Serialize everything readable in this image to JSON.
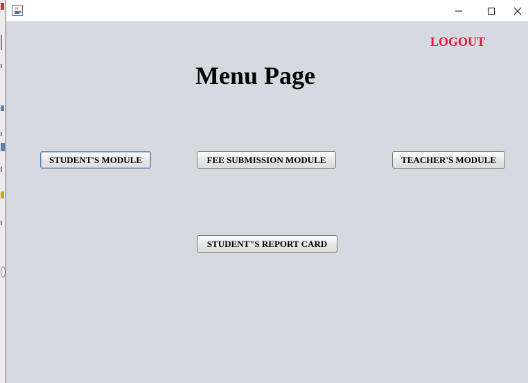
{
  "window": {
    "icon": "java-cup-icon",
    "controls": {
      "minimize_icon": "minimize-icon",
      "maximize_icon": "maximize-icon",
      "close_icon": "close-icon"
    }
  },
  "header": {
    "logout_label": "LOGOUT",
    "logout_color": "#e8123a"
  },
  "main": {
    "title": "Menu Page",
    "buttons": {
      "student_module": "STUDENT'S MODULE",
      "fee_submission_module": "FEE SUBMISSION MODULE",
      "teacher_module": "TEACHER'S MODULE",
      "report_card": "STUDENT\"S REPORT CARD"
    }
  },
  "colors": {
    "window_background": "#d6d9e0",
    "titlebar_background": "#ffffff"
  }
}
